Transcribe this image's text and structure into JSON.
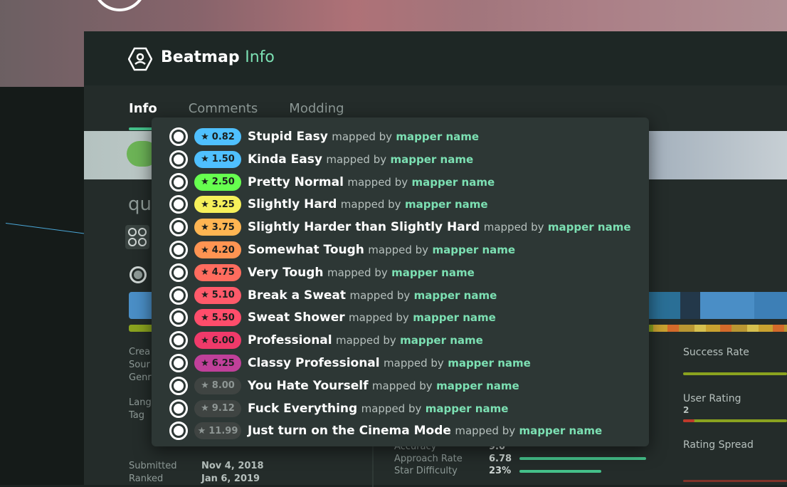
{
  "header": {
    "title": "Beatmap",
    "title_accent": "Info",
    "icon": "user-hexagon-icon"
  },
  "tabs": [
    {
      "label": "Info",
      "active": true
    },
    {
      "label": "Comments",
      "active": false
    },
    {
      "label": "Modding",
      "active": false
    }
  ],
  "beatmap": {
    "title_partial": "qu"
  },
  "metadata": {
    "labels": [
      "Crea",
      "Sour",
      "Genr",
      "Lang",
      "Tag"
    ],
    "user_rating_value": "2",
    "submitted_label": "Submitted",
    "submitted_value": "Nov 4, 2018",
    "ranked_label": "Ranked",
    "ranked_value": "Jan 6, 2019"
  },
  "right_stats": {
    "success_rate": "Success Rate",
    "user_rating": "User Rating",
    "rating_spread": "Rating Spread"
  },
  "stats": [
    {
      "label": "Accuracy",
      "value": "9.0"
    },
    {
      "label": "Approach Rate",
      "value": "6.78"
    },
    {
      "label": "Star Difficulty",
      "value": "23%"
    }
  ],
  "colors": {
    "accent": "#7ce0b3",
    "panel": "#242c2a",
    "dropdown": "#2d3735"
  },
  "dropdown": {
    "mapped_by_text": "mapped by",
    "difficulties": [
      {
        "stars": "0.82",
        "name": "Stupid Easy",
        "mapper": "mapper name",
        "color": "#4fc0ff",
        "text_color": "#1a1f1e"
      },
      {
        "stars": "1.50",
        "name": "Kinda Easy",
        "mapper": "mapper name",
        "color": "#4fc0ff",
        "text_color": "#1a1f1e"
      },
      {
        "stars": "2.50",
        "name": "Pretty Normal",
        "mapper": "mapper name",
        "color": "#66ff4f",
        "text_color": "#1a1f1e"
      },
      {
        "stars": "3.25",
        "name": "Slightly Hard",
        "mapper": "mapper name",
        "color": "#f6f05a",
        "text_color": "#1a1f1e"
      },
      {
        "stars": "3.75",
        "name": "Slightly Harder than Slightly Hard",
        "mapper": "mapper name",
        "color": "#ffb552",
        "text_color": "#1a1f1e"
      },
      {
        "stars": "4.20",
        "name": "Somewhat Tough",
        "mapper": "mapper name",
        "color": "#ff9452",
        "text_color": "#1a1f1e"
      },
      {
        "stars": "4.75",
        "name": "Very Tough",
        "mapper": "mapper name",
        "color": "#ff6c5e",
        "text_color": "#1a1f1e"
      },
      {
        "stars": "5.10",
        "name": "Break a Sweat",
        "mapper": "mapper name",
        "color": "#ff5a6a",
        "text_color": "#1a1f1e"
      },
      {
        "stars": "5.50",
        "name": "Sweat Shower",
        "mapper": "mapper name",
        "color": "#ff4d6b",
        "text_color": "#1a1f1e"
      },
      {
        "stars": "6.00",
        "name": "Professional",
        "mapper": "mapper name",
        "color": "#f03a6a",
        "text_color": "#1a1f1e"
      },
      {
        "stars": "6.25",
        "name": "Classy Professional",
        "mapper": "mapper name",
        "color": "#c0409a",
        "text_color": "#1a1f1e"
      },
      {
        "stars": "8.00",
        "name": "You Hate Yourself",
        "mapper": "mapper name",
        "color": "#3f4442",
        "text_color": "#8e9694"
      },
      {
        "stars": "9.12",
        "name": "Fuck Everything",
        "mapper": "mapper name",
        "color": "#3f4442",
        "text_color": "#8e9694"
      },
      {
        "stars": "11.99",
        "name": "Just turn on the Cinema Mode",
        "mapper": "mapper name",
        "color": "#3f4442",
        "text_color": "#8e9694"
      }
    ]
  }
}
